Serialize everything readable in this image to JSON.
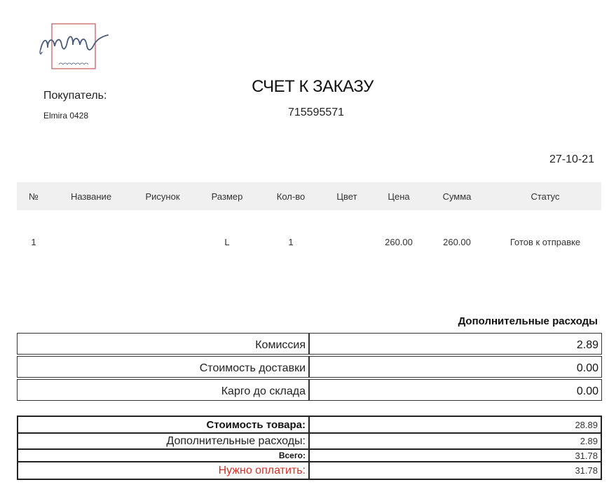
{
  "logo": {
    "text": "mm",
    "subtext": "modagram",
    "frame_color": "#c0585e",
    "ink_color": "#4a5a7a"
  },
  "buyer": {
    "label": "Покупатель:",
    "name": "Elmira 0428"
  },
  "document": {
    "title": "СЧЕТ К ЗАКАЗУ",
    "number": "715595571",
    "date": "27-10-21"
  },
  "items": {
    "headers": [
      "№",
      "Название",
      "Рисунок",
      "Размер",
      "Кол-во",
      "Цвет",
      "Цена",
      "Сумма",
      "Статус"
    ],
    "rows": [
      [
        "1",
        "",
        "",
        "L",
        "1",
        "",
        "260.00",
        "260.00",
        "Готов к отправке"
      ]
    ]
  },
  "extra": {
    "heading": "Дополнительные расходы",
    "rows": [
      {
        "label": "Комиссия",
        "value": "2.89"
      },
      {
        "label": "Стоимость доставки",
        "value": "0.00"
      },
      {
        "label": "Карго до склада",
        "value": "0.00"
      }
    ]
  },
  "totals": {
    "goods_label": "Стоимость товара:",
    "goods_value": "28.89",
    "extra_label": "Дополнительные расходы:",
    "extra_value": "2.89",
    "total_label": "Всего:",
    "total_value": "31.78",
    "pay_label": "Нужно оплатить:",
    "pay_value": "31.78",
    "pay_color": "#d0302a"
  }
}
